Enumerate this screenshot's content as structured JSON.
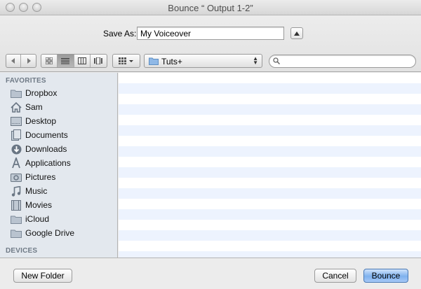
{
  "window": {
    "title": "Bounce “ Output 1-2”"
  },
  "header": {
    "save_as_label": "Save As:",
    "save_as_value": "My Voiceover",
    "location": "Tuts+",
    "search_value": ""
  },
  "sidebar": {
    "favorites_header": "FAVORITES",
    "devices_header": "DEVICES",
    "items": [
      {
        "label": "Dropbox",
        "icon": "folder-icon"
      },
      {
        "label": "Sam",
        "icon": "home-icon"
      },
      {
        "label": "Desktop",
        "icon": "desktop-icon"
      },
      {
        "label": "Documents",
        "icon": "documents-icon"
      },
      {
        "label": "Downloads",
        "icon": "downloads-icon"
      },
      {
        "label": "Applications",
        "icon": "applications-icon"
      },
      {
        "label": "Pictures",
        "icon": "pictures-icon"
      },
      {
        "label": "Music",
        "icon": "music-icon"
      },
      {
        "label": "Movies",
        "icon": "movies-icon"
      },
      {
        "label": "iCloud",
        "icon": "folder-icon"
      },
      {
        "label": "Google Drive",
        "icon": "folder-icon"
      }
    ]
  },
  "footer": {
    "new_folder_label": "New Folder",
    "cancel_label": "Cancel",
    "bounce_label": "Bounce"
  },
  "colors": {
    "sidebar_bg": "#e3e8ee",
    "list_stripe": "#edf3fe",
    "default_button": "#7fb1ee"
  }
}
